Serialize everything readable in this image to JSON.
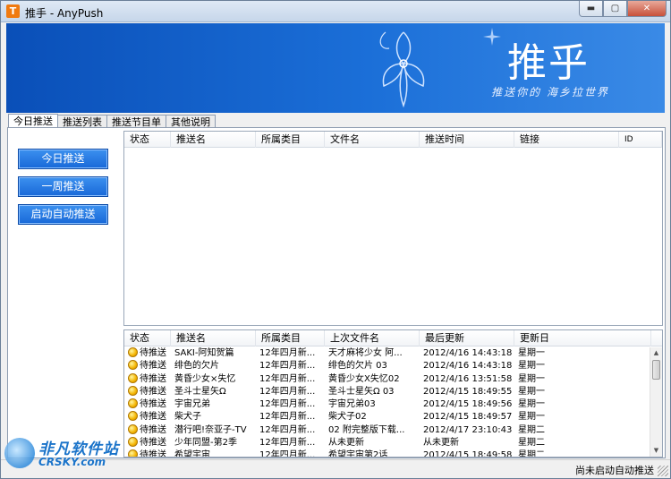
{
  "window": {
    "title": "推手 - AnyPush",
    "app_icon": "T",
    "controls": {
      "minimize": "▬",
      "maximize": "▢",
      "close": "✕"
    }
  },
  "banner": {
    "title": "推乎",
    "slogan": "推送你的 海乡拉世界"
  },
  "tabs": [
    {
      "label": "今日推送",
      "active": true
    },
    {
      "label": "推送列表",
      "active": false
    },
    {
      "label": "推送节目单",
      "active": false
    },
    {
      "label": "其他说明",
      "active": false
    }
  ],
  "left_buttons": [
    {
      "label": "今日推送"
    },
    {
      "label": "一周推送"
    },
    {
      "label": "启动自动推送"
    }
  ],
  "top_grid": {
    "columns": [
      "状态",
      "推送名",
      "所属类目",
      "文件名",
      "推送时间",
      "链接",
      "ID"
    ],
    "rows": []
  },
  "bottom_grid": {
    "columns": [
      "状态",
      "推送名",
      "所属类目",
      "上次文件名",
      "最后更新",
      "更新日"
    ],
    "rows": [
      [
        "待推送",
        "SAKI-阿知贺篇",
        "12年四月新...",
        "天才麻将少女 阿...",
        "2012/4/16 14:43:18",
        "星期一"
      ],
      [
        "待推送",
        "绯色的欠片",
        "12年四月新...",
        "绯色的欠片 03",
        "2012/4/16 14:43:18",
        "星期一"
      ],
      [
        "待推送",
        "黄昏少女×失忆",
        "12年四月新...",
        "黄昏少女X失忆02",
        "2012/4/16 13:51:58",
        "星期一"
      ],
      [
        "待推送",
        "圣斗士星矢Ω",
        "12年四月新...",
        "圣斗士星矢Ω 03",
        "2012/4/15 18:49:55",
        "星期一"
      ],
      [
        "待推送",
        "宇宙兄弟",
        "12年四月新...",
        "宇宙兄弟03",
        "2012/4/15 18:49:56",
        "星期一"
      ],
      [
        "待推送",
        "柴犬子",
        "12年四月新...",
        "柴犬子02",
        "2012/4/15 18:49:57",
        "星期一"
      ],
      [
        "待推送",
        "潜行吧!奈亚子-TV",
        "12年四月新...",
        "02 附完整版下载...",
        "2012/4/17 23:10:43",
        "星期二"
      ],
      [
        "待推送",
        "少年同盟-第2季",
        "12年四月新...",
        "从未更新",
        "从未更新",
        "星期二"
      ],
      [
        "待推送",
        "希望宇宙",
        "12年四月新...",
        "希望宇宙第2话",
        "2012/4/15 18:49:58",
        "星期二"
      ]
    ]
  },
  "status": {
    "text": "尚未启动自动推送"
  },
  "watermark": {
    "cn": "非凡软件站",
    "en": "CRSKY.com"
  }
}
